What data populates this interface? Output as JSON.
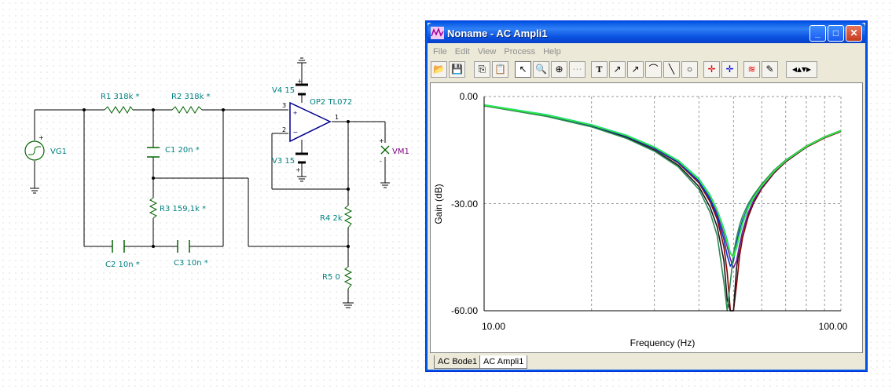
{
  "schematic": {
    "components": {
      "vg1": "VG1",
      "r1": "R1 318k *",
      "r2": "R2 318k *",
      "c1": "C1 20n *",
      "r3": "R3 159,1k *",
      "c2": "C2 10n *",
      "c3": "C3 10n *",
      "v4": "V4 15",
      "v3": "V3 15",
      "op2": "OP2 TL072",
      "r4": "R4 2k",
      "r5": "R5 0",
      "vm1": "VM1"
    },
    "pins": {
      "p3": "3",
      "p2": "2",
      "p1": "1",
      "plus": "+",
      "minus": "-"
    }
  },
  "window": {
    "title": "Noname - AC Ampli1",
    "controls": {
      "minimize": "_",
      "maximize": "□",
      "close": "✕"
    },
    "menu": [
      "File",
      "Edit",
      "View",
      "Process",
      "Help"
    ],
    "toolbar_icons": [
      "open-icon",
      "save-icon",
      "copy-icon",
      "paste-icon",
      "pointer-icon",
      "zoom-in-icon",
      "zoom-100-icon",
      "grid-icon",
      "text-icon",
      "cursor-a-icon",
      "cursor-b-icon",
      "marker-icon",
      "line-icon",
      "circle-icon",
      "cursor-red-icon",
      "cursor-blue-icon",
      "add-curve-icon",
      "probe-icon",
      "scroll-icon"
    ],
    "tabs": [
      "AC Bode1",
      "AC Ampli1"
    ],
    "active_tab": 1
  },
  "chart_data": {
    "type": "line",
    "xlabel": "Frequency (Hz)",
    "ylabel": "Gain (dB)",
    "xscale": "log",
    "xlim": [
      10,
      100
    ],
    "ylim": [
      -60,
      0
    ],
    "yticks": [
      "0.00",
      "-30.00",
      "-60.00"
    ],
    "xticks": [
      "10.00",
      "100.00"
    ],
    "grid": true,
    "x": [
      10,
      15,
      20,
      25,
      30,
      35,
      40,
      43,
      45,
      47,
      48,
      49,
      50,
      51,
      52,
      53,
      55,
      57,
      60,
      65,
      70,
      80,
      90,
      100
    ],
    "series": [
      {
        "color": "#8b0000",
        "values": [
          -2.5,
          -5.4,
          -8.2,
          -11.2,
          -14.6,
          -18.6,
          -24.2,
          -29.5,
          -34.4,
          -42.1,
          -49.2,
          -60.0,
          -60.0,
          -52.8,
          -44.6,
          -39.6,
          -33.6,
          -29.7,
          -25.8,
          -21.4,
          -18.3,
          -14.2,
          -11.6,
          -9.8
        ]
      },
      {
        "color": "#1a1a1a",
        "values": [
          -2.6,
          -5.5,
          -8.4,
          -11.5,
          -15.0,
          -19.2,
          -25.2,
          -31.0,
          -36.5,
          -46.0,
          -57.0,
          -60.0,
          -60.0,
          -48.0,
          -42.0,
          -38.0,
          -32.8,
          -29.2,
          -25.5,
          -21.2,
          -18.2,
          -14.1,
          -11.5,
          -9.7
        ]
      },
      {
        "color": "#7a1fa2",
        "values": [
          -2.4,
          -5.2,
          -8.0,
          -11.0,
          -14.3,
          -18.2,
          -23.5,
          -28.4,
          -32.8,
          -38.5,
          -42.0,
          -45.5,
          -48.0,
          -46.0,
          -41.5,
          -37.8,
          -32.5,
          -29.0,
          -25.4,
          -21.1,
          -18.1,
          -14.0,
          -11.4,
          -9.6
        ]
      },
      {
        "color": "#0033cc",
        "values": [
          -2.5,
          -5.3,
          -8.1,
          -11.1,
          -14.5,
          -18.4,
          -23.8,
          -28.9,
          -33.5,
          -40.0,
          -44.5,
          -47.5,
          -46.0,
          -41.0,
          -37.5,
          -34.8,
          -30.8,
          -28.0,
          -24.8,
          -20.8,
          -17.9,
          -13.9,
          -11.4,
          -9.6
        ]
      },
      {
        "color": "#00c8c8",
        "values": [
          -2.3,
          -5.1,
          -7.9,
          -10.8,
          -14.1,
          -17.9,
          -23.0,
          -27.6,
          -31.8,
          -37.0,
          -40.2,
          -43.8,
          -45.0,
          -42.5,
          -38.8,
          -35.8,
          -31.2,
          -28.3,
          -25.0,
          -20.9,
          -18.0,
          -14.0,
          -11.4,
          -9.6
        ]
      },
      {
        "color": "#2e8b57",
        "values": [
          -2.6,
          -5.6,
          -8.5,
          -11.7,
          -15.3,
          -19.7,
          -26.0,
          -32.5,
          -39.0,
          -52.0,
          -60.0,
          -52.0,
          -44.0,
          -39.5,
          -36.0,
          -33.5,
          -30.0,
          -27.5,
          -24.5,
          -20.6,
          -17.8,
          -13.9,
          -11.3,
          -9.5
        ]
      },
      {
        "color": "#33ee33",
        "values": [
          -2.4,
          -5.2,
          -8.0,
          -10.9,
          -14.2,
          -18.0,
          -23.2,
          -27.9,
          -32.0,
          -37.5,
          -41.0,
          -44.0,
          -45.0,
          -42.0,
          -38.5,
          -35.5,
          -31.0,
          -28.2,
          -25.0,
          -20.9,
          -18.0,
          -14.0,
          -11.4,
          -9.6
        ]
      }
    ]
  }
}
